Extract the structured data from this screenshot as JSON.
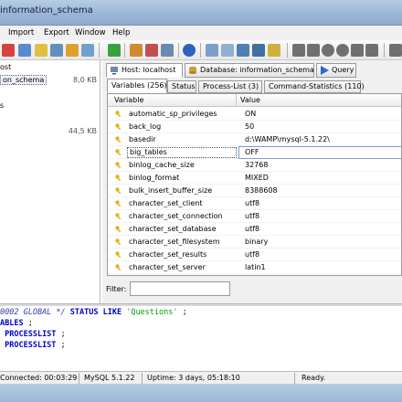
{
  "window": {
    "title": "information_schema"
  },
  "menu": [
    "Import",
    "Export",
    "Window",
    "Help"
  ],
  "left_tree": [
    {
      "label": "ost",
      "size": ""
    },
    {
      "label": "on_schema",
      "size": "8,0 KB",
      "selected": true
    },
    {
      "label": "s",
      "size": ""
    },
    {
      "label": "",
      "size": "44,5 KB"
    }
  ],
  "host_tabs": [
    {
      "label": "Host: localhost",
      "icon": "host-icon"
    },
    {
      "label": "Database: information_schema",
      "icon": "database-icon"
    },
    {
      "label": "Query",
      "icon": "play-icon"
    }
  ],
  "sub_tabs": [
    {
      "label": "Variables (256)"
    },
    {
      "label": "Status"
    },
    {
      "label": "Process-List (3)"
    },
    {
      "label": "Command-Statistics (110)"
    }
  ],
  "grid": {
    "col_variable": "Variable",
    "col_value": "Value",
    "rows": [
      {
        "name": "automatic_sp_privileges",
        "value": "ON"
      },
      {
        "name": "back_log",
        "value": "50"
      },
      {
        "name": "basedir",
        "value": "d:\\WAMP\\mysql-5.1.22\\"
      },
      {
        "name": "big_tables",
        "value": "OFF",
        "selected": true
      },
      {
        "name": "binlog_cache_size",
        "value": "32768"
      },
      {
        "name": "binlog_format",
        "value": "MIXED"
      },
      {
        "name": "bulk_insert_buffer_size",
        "value": "8388608"
      },
      {
        "name": "character_set_client",
        "value": "utf8"
      },
      {
        "name": "character_set_connection",
        "value": "utf8"
      },
      {
        "name": "character_set_database",
        "value": "utf8"
      },
      {
        "name": "character_set_filesystem",
        "value": "binary"
      },
      {
        "name": "character_set_results",
        "value": "utf8"
      },
      {
        "name": "character_set_server",
        "value": "latin1"
      }
    ]
  },
  "filter": {
    "label": "Filter:",
    "value": ""
  },
  "log": {
    "line1": {
      "comment": "0002 GLOBAL */",
      "kw1": "STATUS LIKE",
      "str": "'Questions'",
      "rest": " ;"
    },
    "line2": {
      "kw": "ABLES",
      "rest": " ;"
    },
    "line3": {
      "kw": "PROCESSLIST",
      "rest": " ;"
    },
    "line4": {
      "kw": "PROCESSLIST",
      "rest": " ;"
    }
  },
  "status": {
    "connected": "Connected: 00:03:29",
    "version": "MySQL 5.1.22",
    "uptime": "Uptime: 3 days, 05:18:10",
    "state": "Ready."
  },
  "colors": {
    "key_icon": "#e8b020",
    "selection_border": "#7aa0d0",
    "sql_keyword": "#0000c8",
    "sql_string": "#00a000",
    "sql_comment": "#3a3ab0"
  }
}
